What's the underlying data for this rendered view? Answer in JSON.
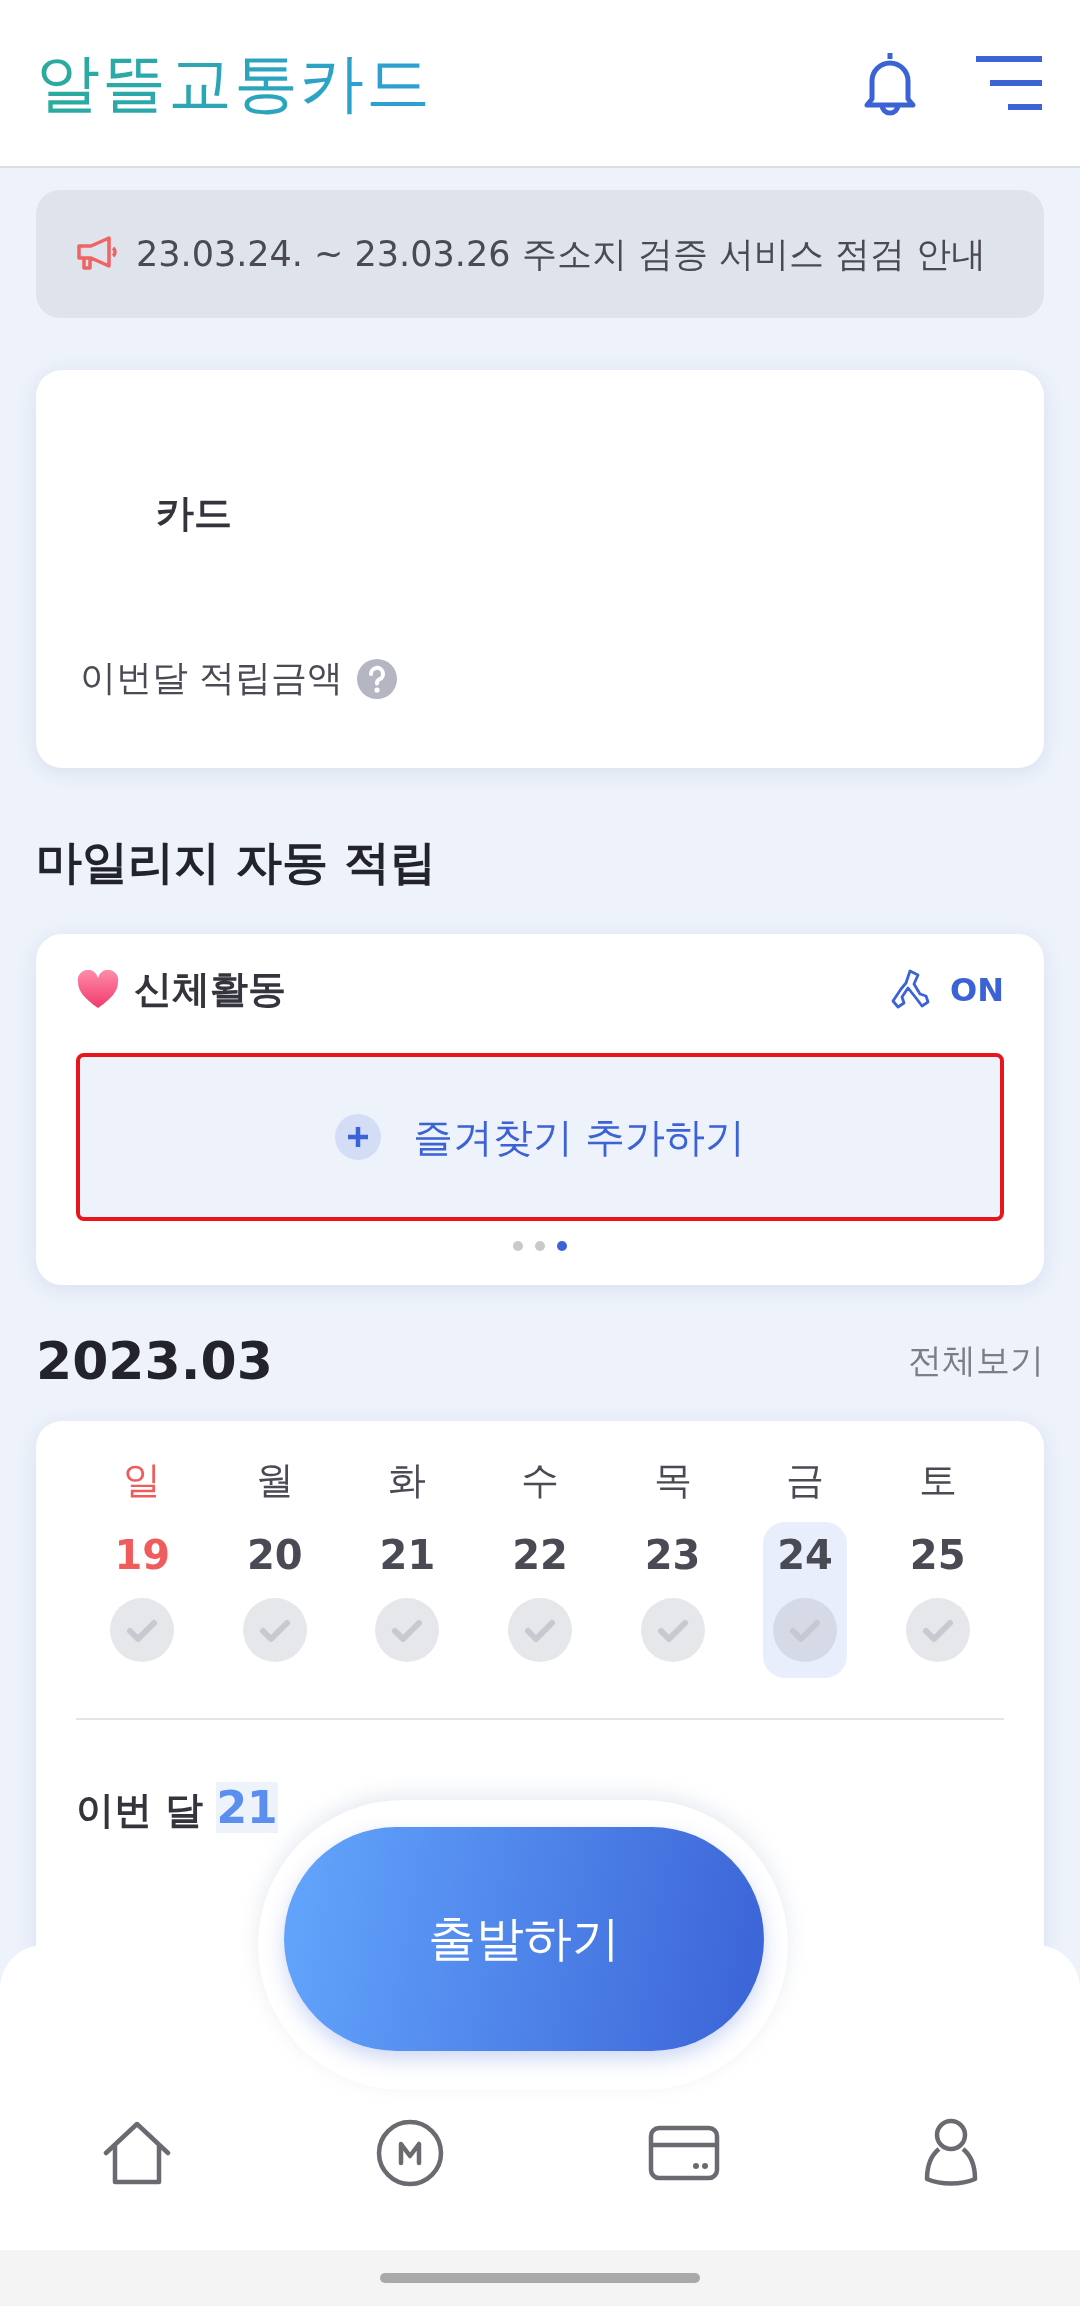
{
  "header": {
    "logo": "알뜰교통카드"
  },
  "notice": {
    "text": "23.03.24. ~ 23.03.26 주소지 검증 서비스 점검 안내"
  },
  "card": {
    "title": "카드",
    "balance_label": "이번달 적립금액"
  },
  "section_title": "마일리지 자동 적립",
  "activity": {
    "title": "신체활동",
    "auto": {
      "label": "ON",
      "on": true
    },
    "add_button": "즐겨찾기 추가하기",
    "pager": [
      {
        "selected": false
      },
      {
        "selected": false
      },
      {
        "selected": true
      }
    ]
  },
  "month": {
    "title": "2023.03",
    "link": "전체보기"
  },
  "days": [
    {
      "name": "일",
      "date": "19",
      "holiday": true,
      "checked": false,
      "selected": false
    },
    {
      "name": "월",
      "date": "20",
      "holiday": false,
      "checked": false,
      "selected": false
    },
    {
      "name": "화",
      "date": "21",
      "holiday": false,
      "checked": false,
      "selected": false
    },
    {
      "name": "수",
      "date": "22",
      "holiday": false,
      "checked": false,
      "selected": false
    },
    {
      "name": "목",
      "date": "23",
      "holiday": false,
      "checked": false,
      "selected": false
    },
    {
      "name": "금",
      "date": "24",
      "holiday": false,
      "checked": false,
      "selected": true
    },
    {
      "name": "토",
      "date": "25",
      "holiday": false,
      "checked": false,
      "selected": false
    }
  ],
  "summary": "이번 달 **21**",
  "go_button": "출발하기"
}
